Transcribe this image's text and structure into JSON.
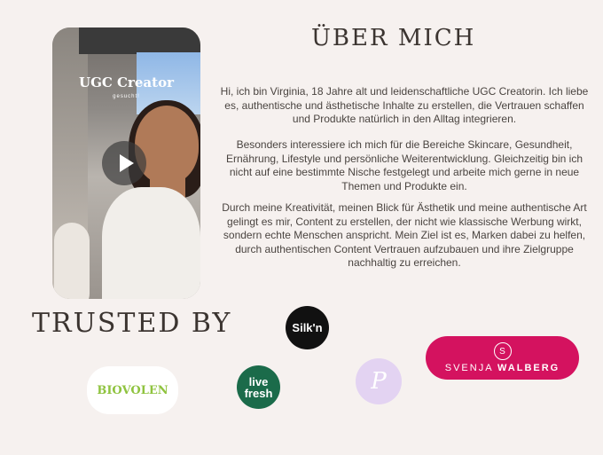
{
  "video": {
    "title": "UGC Creator",
    "subtitle": "gesucht!"
  },
  "heading": "ÜBER MICH",
  "paragraphs": [
    "Hi, ich bin Virginia, 18 Jahre alt und leidenschaftliche UGC Creatorin. Ich liebe es, authentische und ästhetische Inhalte zu erstellen, die Vertrauen schaffen und Produkte natürlich in den Alltag integrieren.",
    "Besonders interessiere ich mich für die Bereiche Skincare, Gesundheit, Ernährung, Lifestyle und persönliche Weiterentwicklung. Gleichzeitig bin ich nicht auf eine bestimmte Nische festgelegt und arbeite mich gerne in neue Themen und Produkte ein.",
    "Durch meine Kreativität, meinen Blick für Ästhetik und meine authentische Art gelingt es mir, Content zu erstellen, der nicht wie klassische Werbung wirkt, sondern echte Menschen anspricht. Mein Ziel ist es, Marken dabei zu helfen, durch authentischen Content Vertrauen aufzubauen und ihre Zielgruppe nachhaltig zu erreichen."
  ],
  "trusted_by": "TRUSTED BY",
  "logos": {
    "silkn": "Silk'n",
    "svenja_part1": "SVENJA",
    "svenja_part2": "WALBERG",
    "biovolen": "BIOVOLEN",
    "livefresh_line1": "live",
    "livefresh_line2": "fresh"
  },
  "colors": {
    "background": "#f6f1ef",
    "svenja_pink": "#d4125f",
    "livefresh_green": "#1b6b4a",
    "biovolen_green": "#8fc33f",
    "lavender": "#e3d3f2"
  }
}
